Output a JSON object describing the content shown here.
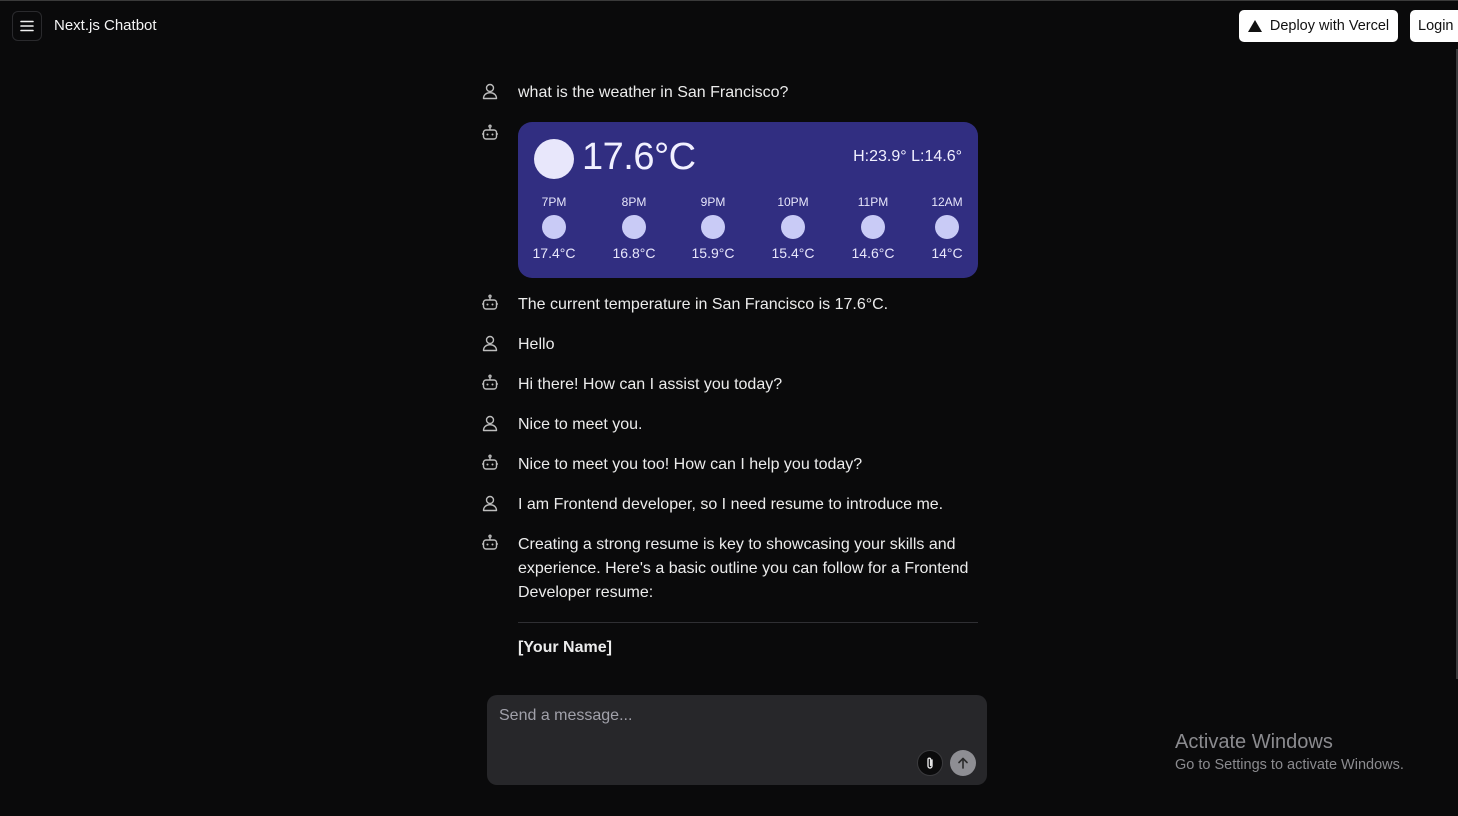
{
  "header": {
    "app_title": "Next.js Chatbot",
    "deploy_label": "Deploy with Vercel",
    "login_label": "Login"
  },
  "messages": [
    {
      "role": "user",
      "text": "what is the weather in San Francisco?"
    },
    {
      "role": "assistant",
      "widget": "weather"
    },
    {
      "role": "assistant",
      "text": "The current temperature in San Francisco is 17.6°C."
    },
    {
      "role": "user",
      "text": "Hello"
    },
    {
      "role": "assistant",
      "text": "Hi there! How can I assist you today?"
    },
    {
      "role": "user",
      "text": "Nice to meet you."
    },
    {
      "role": "assistant",
      "text": "Nice to meet you too! How can I help you today?"
    },
    {
      "role": "user",
      "text": "I am Frontend developer, so I need resume to introduce me."
    },
    {
      "role": "assistant",
      "text": "Creating a strong resume is key to showcasing your skills and experience. Here's a basic outline you can follow for a Frontend Developer resume:",
      "heading": "[Your Name]"
    }
  ],
  "weather": {
    "current_temp": "17.6°C",
    "hi_lo": "H:23.9° L:14.6°",
    "hourly": [
      {
        "time": "7PM",
        "temp": "17.4°C"
      },
      {
        "time": "8PM",
        "temp": "16.8°C"
      },
      {
        "time": "9PM",
        "temp": "15.9°C"
      },
      {
        "time": "10PM",
        "temp": "15.4°C"
      },
      {
        "time": "11PM",
        "temp": "14.6°C"
      },
      {
        "time": "12AM",
        "temp": "14°C"
      }
    ],
    "colors": {
      "card": "#312e81",
      "sun": "#c9cbf6"
    }
  },
  "composer": {
    "placeholder": "Send a message...",
    "value": ""
  },
  "watermark": {
    "title": "Activate Windows",
    "subtitle": "Go to Settings to activate Windows."
  },
  "icons": {
    "menu": "hamburger-icon",
    "deploy": "vercel-triangle-icon",
    "user": "user-icon",
    "assistant": "bot-icon",
    "attach": "paperclip-icon",
    "send": "arrow-up-icon"
  }
}
